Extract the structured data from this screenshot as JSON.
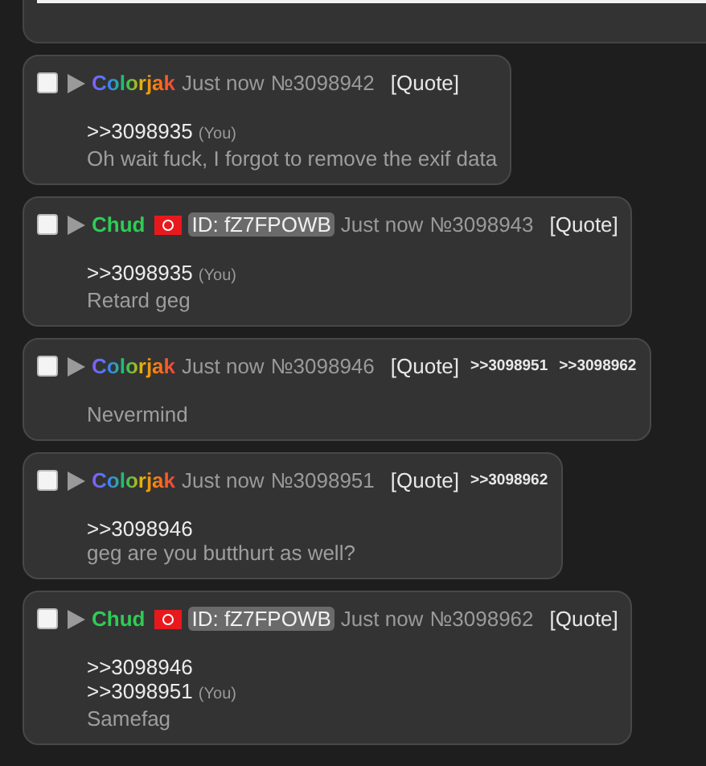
{
  "posts": [
    {
      "checked": false,
      "name": "Colorjak",
      "kind": "rainbow",
      "flag": false,
      "time": "Just now",
      "number": "№3098942",
      "quote_link": "[Quote]",
      "lines": [
        {
          "kind": "quote",
          "text": ">>3098935",
          "you": "(You)"
        },
        {
          "kind": "text",
          "text": "Oh wait fuck, I forgot to remove the exif data"
        }
      ]
    },
    {
      "checked": false,
      "name": "Chud",
      "kind": "green",
      "flag": true,
      "id": "ID: fZ7FPOWB",
      "time": "Just now",
      "number": "№3098943",
      "quote_link": "[Quote]",
      "lines": [
        {
          "kind": "quote",
          "text": ">>3098935",
          "you": "(You)"
        },
        {
          "kind": "text",
          "text": "Retard geg"
        }
      ]
    },
    {
      "checked": false,
      "name": "Colorjak",
      "kind": "rainbow",
      "flag": false,
      "time": "Just now",
      "number": "№3098946",
      "quote_link": "[Quote]",
      "replies": [
        ">>3098951",
        ">>3098962"
      ],
      "lines": [
        {
          "kind": "text",
          "text": "Nevermind"
        }
      ]
    },
    {
      "checked": false,
      "name": "Colorjak",
      "kind": "rainbow",
      "flag": false,
      "time": "Just now",
      "number": "№3098951",
      "quote_link": "[Quote]",
      "replies": [
        ">>3098962"
      ],
      "lines": [
        {
          "kind": "quote",
          "text": ">>3098946"
        },
        {
          "kind": "text",
          "text": "geg are you butthurt as well?"
        }
      ]
    },
    {
      "checked": false,
      "name": "Chud",
      "kind": "green",
      "flag": true,
      "id": "ID: fZ7FPOWB",
      "time": "Just now",
      "number": "№3098962",
      "quote_link": "[Quote]",
      "lines": [
        {
          "kind": "quote",
          "text": ">>3098946"
        },
        {
          "kind": "quote",
          "text": ">>3098951",
          "you": "(You)"
        },
        {
          "kind": "text",
          "text": "Samefag"
        }
      ]
    }
  ]
}
